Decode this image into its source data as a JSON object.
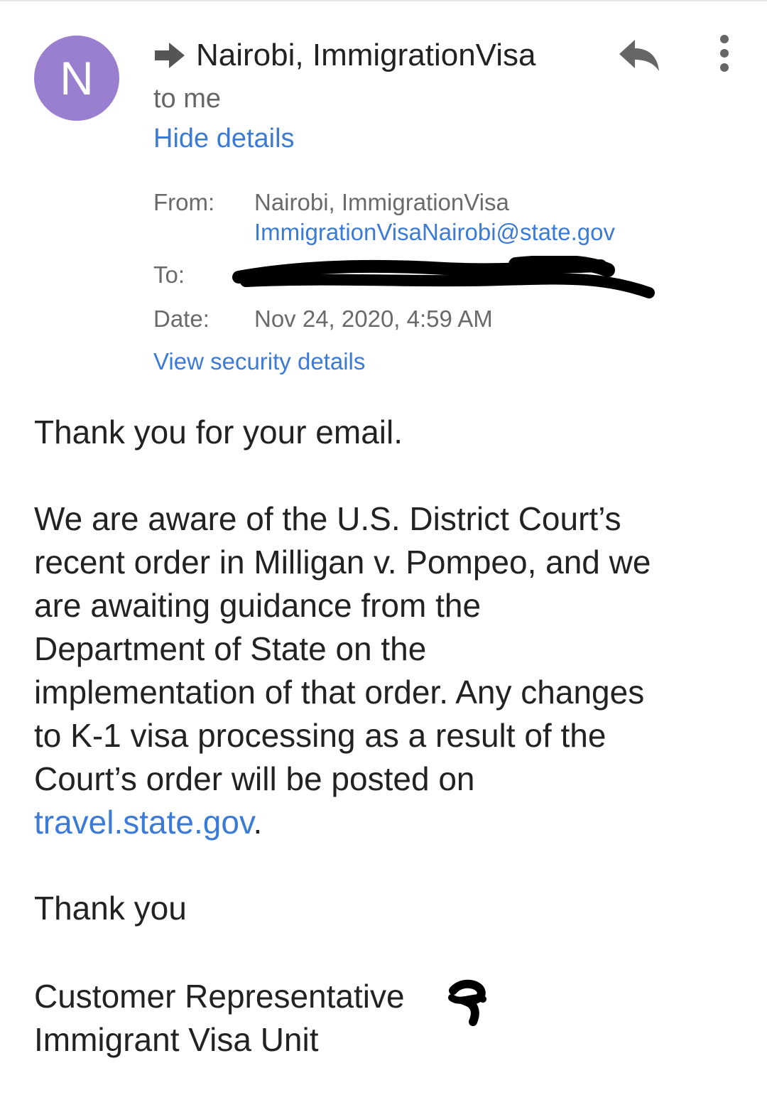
{
  "header": {
    "avatar_letter": "N",
    "sender_name": "Nairobi, ImmigrationVisa",
    "recipient_summary": "to me",
    "hide_details_label": "Hide details",
    "icons": {
      "forward": "forward-arrow-icon",
      "reply": "reply-icon",
      "more": "more-vert-icon"
    },
    "colors": {
      "avatar_bg": "#9a7fd0",
      "link": "#3b7bd6"
    }
  },
  "details": {
    "from_label": "From:",
    "from_name": "Nairobi, ImmigrationVisa",
    "from_email": "ImmigrationVisaNairobi@state.gov",
    "to_label": "To:",
    "date_label": "Date:",
    "date_value": "Nov 24, 2020, 4:59 AM",
    "security_link": "View security details"
  },
  "body": {
    "greeting": "Thank you for your email.",
    "paragraph_lines": [
      "We are aware of the U.S. District Court’s",
      "recent order in Milligan v. Pompeo, and we",
      "are awaiting guidance from the",
      "Department of State on the",
      "implementation of that order.  Any changes",
      "to K-1 visa processing as a result of the",
      "Court’s order will be posted on"
    ],
    "link_text": "travel.state.gov",
    "link_suffix": ".",
    "closing": "Thank you",
    "signature_line1": "Customer Representative",
    "signature_line2": "Immigrant Visa Unit"
  }
}
